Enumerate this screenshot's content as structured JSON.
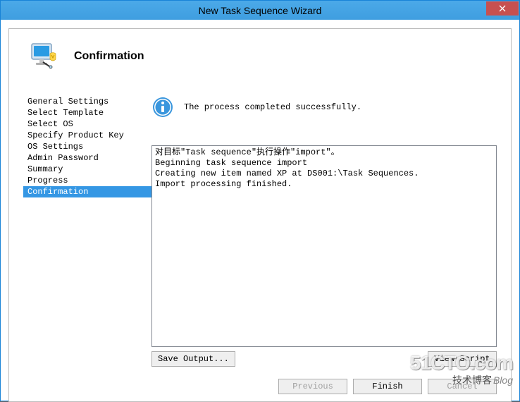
{
  "window": {
    "title": "New Task Sequence Wizard"
  },
  "header": {
    "title": "Confirmation"
  },
  "sidebar": {
    "items": [
      {
        "label": "General Settings",
        "selected": false
      },
      {
        "label": "Select Template",
        "selected": false
      },
      {
        "label": "Select OS",
        "selected": false
      },
      {
        "label": "Specify Product Key",
        "selected": false
      },
      {
        "label": "OS Settings",
        "selected": false
      },
      {
        "label": "Admin Password",
        "selected": false
      },
      {
        "label": "Summary",
        "selected": false
      },
      {
        "label": "Progress",
        "selected": false
      },
      {
        "label": "Confirmation",
        "selected": true
      }
    ]
  },
  "main": {
    "status_message": "The process completed successfully.",
    "log_lines": [
      "对目标\"Task sequence\"执行操作\"import\"。",
      "Beginning task sequence import",
      "Creating new item named XP at DS001:\\Task Sequences.",
      "Import processing finished."
    ],
    "save_output_label": "Save Output...",
    "view_script_label": "View Script"
  },
  "footer": {
    "previous_label": "Previous",
    "finish_label": "Finish",
    "cancel_label": "Cancel"
  },
  "watermark": {
    "line1": "51CTO.com",
    "line2_a": "技术博客",
    "line2_b": "Blog"
  }
}
